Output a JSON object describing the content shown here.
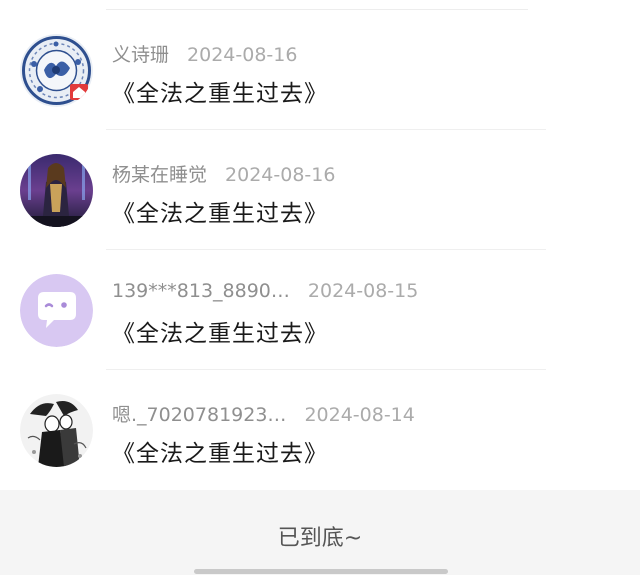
{
  "comments": [
    {
      "username": "义诗珊",
      "date": "2024-08-16",
      "text": "《全法之重生过去》",
      "avatar_icon": "porcelain-plate-avatar"
    },
    {
      "username": "杨某在睡觉",
      "date": "2024-08-16",
      "text": "《全法之重生过去》",
      "avatar_icon": "stage-performer-avatar"
    },
    {
      "username": "139***813_8890…",
      "date": "2024-08-15",
      "text": "《全法之重生过去》",
      "avatar_icon": "purple-chat-bubble-avatar"
    },
    {
      "username": "嗯._7020781923…",
      "date": "2024-08-14",
      "text": "《全法之重生过去》",
      "avatar_icon": "sketch-character-avatar"
    }
  ],
  "footer": {
    "end_text": "已到底~"
  },
  "colors": {
    "avatar_purple": "#d8c8f2",
    "footer_bg": "#f5f5f5",
    "meta_gray": "#9b9b9b"
  }
}
